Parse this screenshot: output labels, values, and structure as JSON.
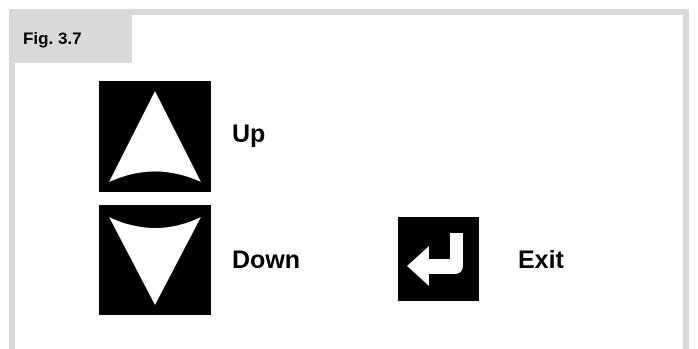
{
  "figure": {
    "label": "Fig. 3.7"
  },
  "keys": {
    "up": {
      "icon": "arrow-up-icon",
      "label": "Up"
    },
    "down": {
      "icon": "arrow-down-icon",
      "label": "Down"
    },
    "exit": {
      "icon": "return-arrow-icon",
      "label": "Exit"
    }
  },
  "colors": {
    "frame": "#d9d9d9",
    "key_background": "#000000",
    "key_symbol": "#ffffff"
  }
}
